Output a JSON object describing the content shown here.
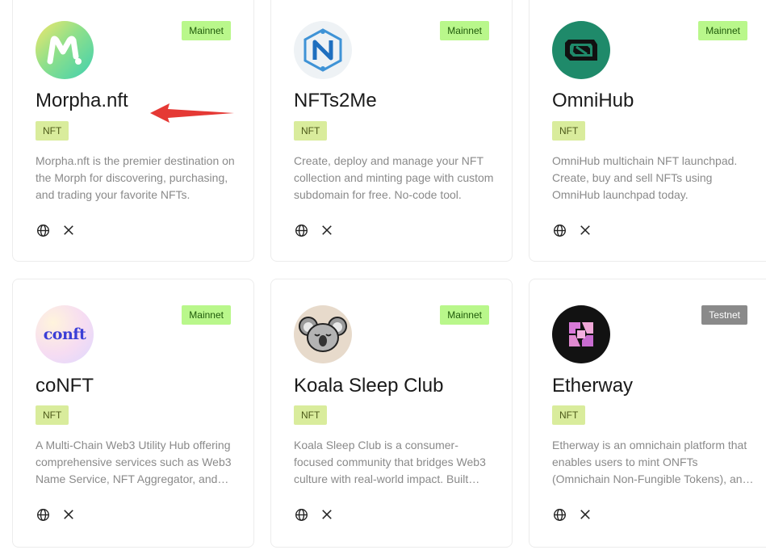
{
  "cards": [
    {
      "name": "Morpha.nft",
      "network": "Mainnet",
      "category": "NFT",
      "description": "Morpha.nft is the premier destination on the Morph for discovering, purchasing, and trading your favorite NFTs.",
      "logo_text": "M",
      "icons": [
        "globe-icon",
        "x-icon"
      ]
    },
    {
      "name": "NFTs2Me",
      "network": "Mainnet",
      "category": "NFT",
      "description": "Create, deploy and manage your NFT collection and minting page with custom subdomain for free. No-code tool.",
      "logo_text": "N",
      "icons": [
        "globe-icon",
        "x-icon"
      ]
    },
    {
      "name": "OmniHub",
      "network": "Mainnet",
      "category": "NFT",
      "description": "OmniHub multichain NFT launchpad. Create, buy and sell NFTs using OmniHub launchpad today.",
      "logo_text": "",
      "icons": [
        "globe-icon",
        "x-icon"
      ]
    },
    {
      "name": "coNFT",
      "network": "Mainnet",
      "category": "NFT",
      "description": "A Multi-Chain Web3 Utility Hub offering comprehensive services such as Web3 Name Service, NFT Aggregator, and more.",
      "logo_text": "conft",
      "icons": [
        "globe-icon",
        "x-icon"
      ]
    },
    {
      "name": "Koala Sleep Club",
      "network": "Mainnet",
      "category": "NFT",
      "description": "Koala Sleep Club is a consumer-focused community that bridges Web3 culture with real-world impact. Built natively on Morph.",
      "logo_text": "",
      "icons": [
        "globe-icon",
        "x-icon"
      ]
    },
    {
      "name": "Etherway",
      "network": "Testnet",
      "category": "NFT",
      "description": "Etherway is an omnichain platform that enables users to mint ONFTs (Omnichain Non-Fungible Tokens), and more.",
      "logo_text": "",
      "icons": [
        "globe-icon",
        "x-icon"
      ]
    }
  ],
  "colors": {
    "mainnet_bg": "#b9f78b",
    "testnet_bg": "#8a8a8a",
    "category_bg": "#d9ec9c",
    "arrow": "#e53935"
  }
}
